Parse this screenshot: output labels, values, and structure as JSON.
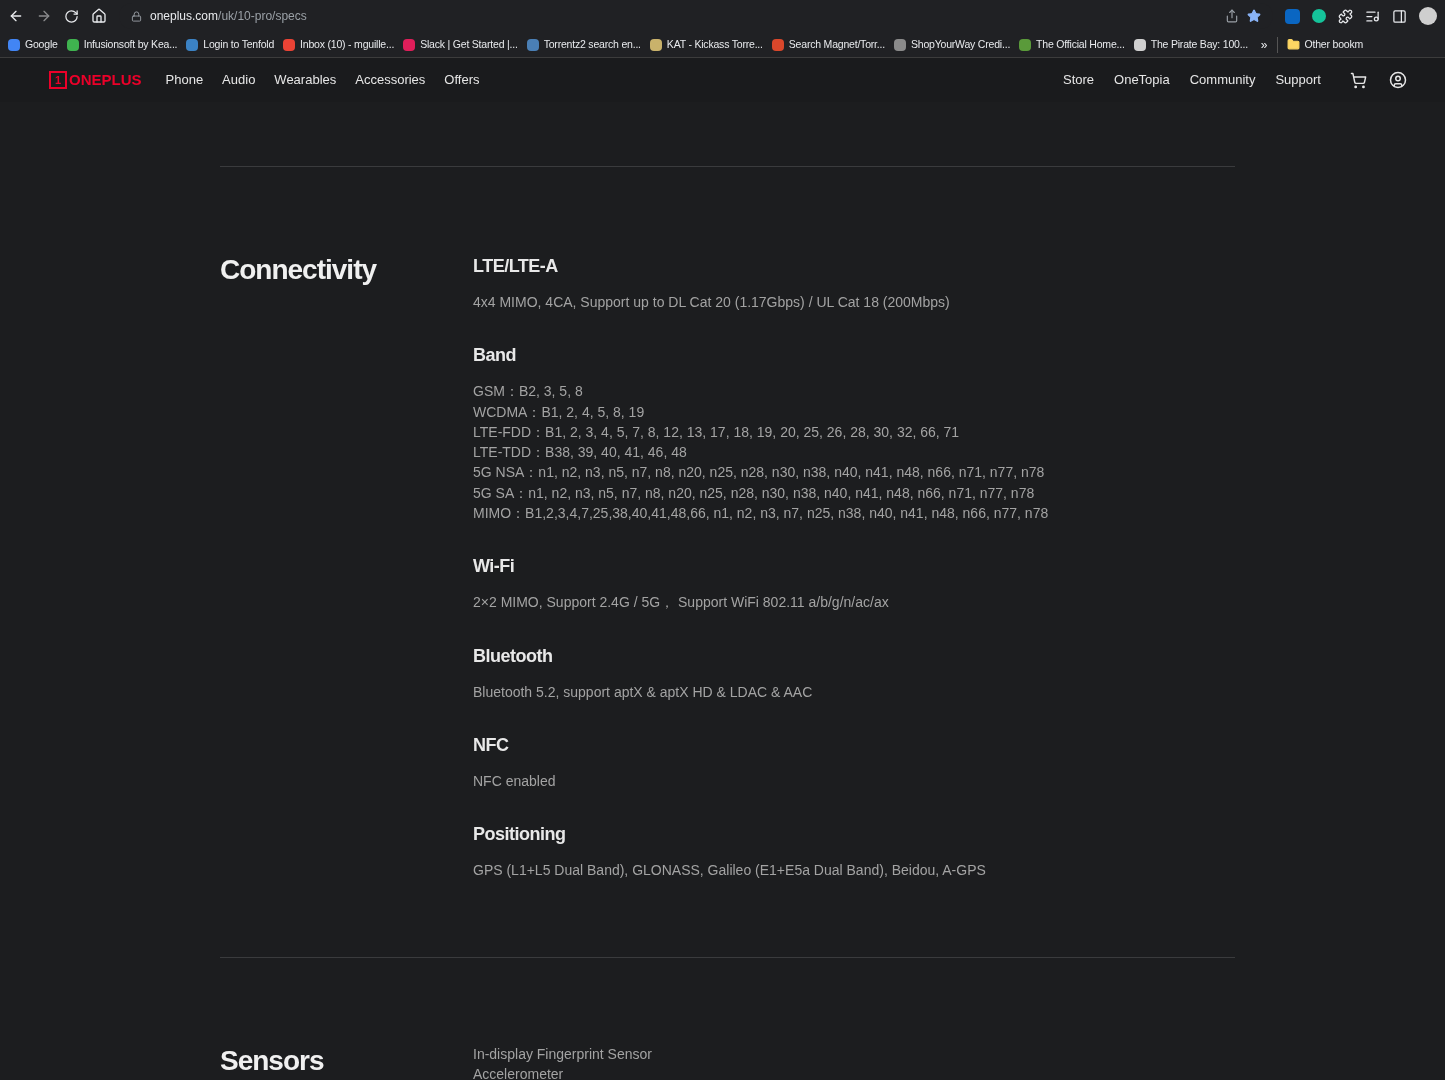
{
  "browser": {
    "url_host": "oneplus.com",
    "url_path": "/uk/10-pro/specs",
    "bookmarks": [
      {
        "label": "Google",
        "color": "#4285f4"
      },
      {
        "label": "Infusionsoft by Kea...",
        "color": "#3fb34f"
      },
      {
        "label": "Login to Tenfold",
        "color": "#3b82c4"
      },
      {
        "label": "Inbox (10) - mguille...",
        "color": "#ea4335"
      },
      {
        "label": "Slack | Get Started |...",
        "color": "#e01e5a"
      },
      {
        "label": "Torrentz2 search en...",
        "color": "#4a7fb5"
      },
      {
        "label": "KAT - Kickass Torre...",
        "color": "#c9b26b"
      },
      {
        "label": "Search Magnet/Torr...",
        "color": "#d9472b"
      },
      {
        "label": "ShopYourWay Credi...",
        "color": "#8a8a8a"
      },
      {
        "label": "The Official Home...",
        "color": "#5a9a3a"
      },
      {
        "label": "The Pirate Bay: 100...",
        "color": "#d0d0d0"
      }
    ],
    "overflow": "»",
    "other_bookmarks": "Other bookm"
  },
  "nav": {
    "logo": "ONEPLUS",
    "logo_mark": "1",
    "left": [
      "Phone",
      "Audio",
      "Wearables",
      "Accessories",
      "Offers"
    ],
    "right": [
      "Store",
      "OneTopia",
      "Community",
      "Support"
    ]
  },
  "sections": [
    {
      "heading": "Connectivity",
      "items": [
        {
          "title": "LTE/LTE-A",
          "lines": [
            "4x4 MIMO, 4CA, Support up to DL Cat 20 (1.17Gbps) / UL Cat 18 (200Mbps)"
          ]
        },
        {
          "title": "Band",
          "lines": [
            "GSM：B2, 3, 5, 8",
            "WCDMA：B1, 2, 4, 5, 8, 19",
            "LTE-FDD：B1, 2, 3, 4, 5, 7, 8, 12, 13, 17, 18, 19, 20, 25, 26, 28, 30, 32, 66, 71",
            "LTE-TDD：B38, 39, 40, 41, 46, 48",
            "5G NSA：n1, n2, n3, n5, n7, n8, n20, n25, n28, n30, n38, n40, n41, n48, n66, n71, n77, n78",
            "5G SA：n1, n2, n3, n5, n7, n8, n20, n25, n28, n30, n38, n40, n41, n48, n66, n71, n77, n78",
            "MIMO：B1,2,3,4,7,25,38,40,41,48,66, n1, n2, n3, n7, n25, n38, n40, n41, n48, n66, n77, n78"
          ]
        },
        {
          "title": "Wi-Fi",
          "lines": [
            "2×2 MIMO, Support 2.4G / 5G， Support WiFi 802.11 a/b/g/n/ac/ax"
          ]
        },
        {
          "title": "Bluetooth",
          "lines": [
            "Bluetooth 5.2, support aptX & aptX HD & LDAC & AAC"
          ]
        },
        {
          "title": "NFC",
          "lines": [
            "NFC enabled"
          ]
        },
        {
          "title": "Positioning",
          "lines": [
            "GPS (L1+L5 Dual Band), GLONASS, Galileo (E1+E5a Dual Band), Beidou, A-GPS"
          ]
        }
      ]
    },
    {
      "heading": "Sensors",
      "items": [
        {
          "lines": [
            "In-display Fingerprint Sensor",
            "Accelerometer"
          ]
        }
      ]
    }
  ]
}
